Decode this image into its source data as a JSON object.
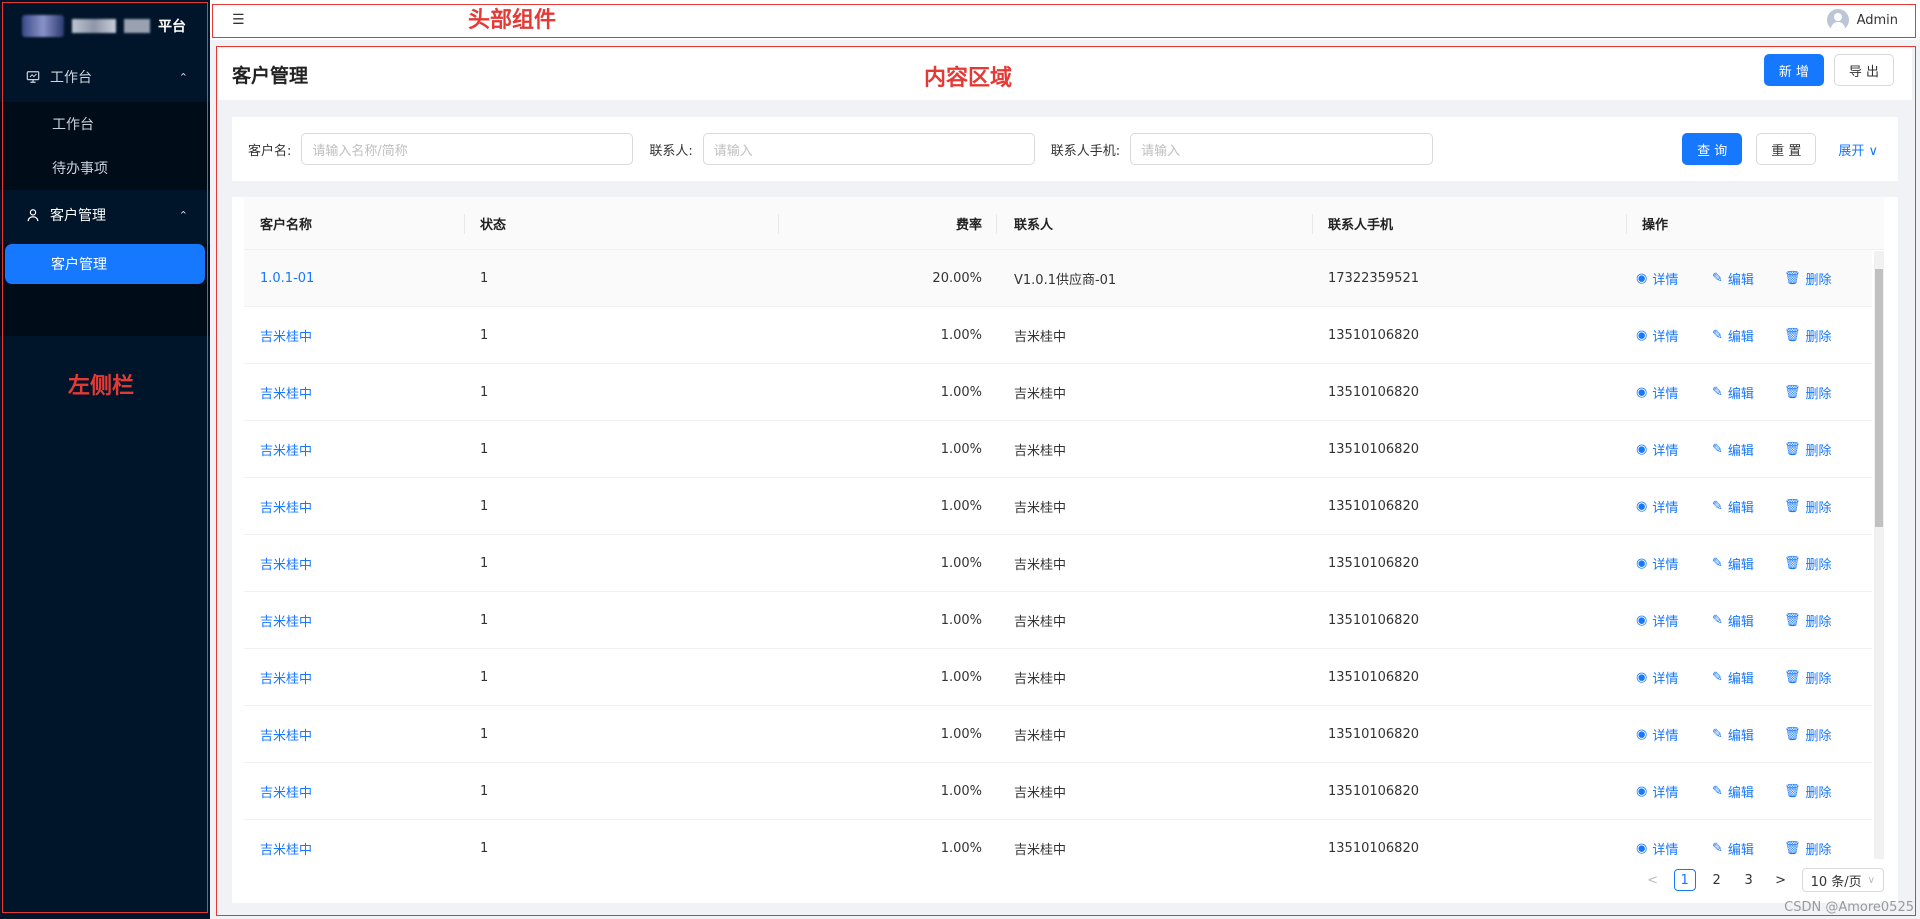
{
  "sidebar": {
    "brand_title": "平台",
    "groups": [
      {
        "label": "工作台",
        "icon": "monitor-icon",
        "chevron": "⌃",
        "items": [
          "工作台",
          "待办事项"
        ]
      },
      {
        "label": "客户管理",
        "icon": "user-icon",
        "chevron": "⌃",
        "items": [
          "客户管理"
        ]
      }
    ]
  },
  "header": {
    "toggle_icon": "☰",
    "user_name": "Admin"
  },
  "annotations": {
    "header": "头部组件",
    "content": "内容区域",
    "sidebar": "左侧栏"
  },
  "page": {
    "title": "客户管理",
    "add_label": "新 增",
    "export_label": "导 出"
  },
  "filter": {
    "customer_label": "客户名:",
    "customer_placeholder": "请输入名称/简称",
    "contact_label": "联系人:",
    "contact_placeholder": "请输入",
    "phone_label": "联系人手机:",
    "phone_placeholder": "请输入",
    "search_label": "查 询",
    "reset_label": "重 置",
    "expand_label": "展开 ∨"
  },
  "table": {
    "columns": [
      "客户名称",
      "状态",
      "费率",
      "联系人",
      "联系人手机",
      "操作"
    ],
    "actions": {
      "view": "详情",
      "edit": "编辑",
      "delete": "删除"
    },
    "rows": [
      {
        "name": "1.0.1-01",
        "status": "1",
        "rate": "20.00%",
        "contact": "V1.0.1供应商-01",
        "phone": "17322359521"
      },
      {
        "name": "吉米桂中",
        "status": "1",
        "rate": "1.00%",
        "contact": "吉米桂中",
        "phone": "13510106820"
      },
      {
        "name": "吉米桂中",
        "status": "1",
        "rate": "1.00%",
        "contact": "吉米桂中",
        "phone": "13510106820"
      },
      {
        "name": "吉米桂中",
        "status": "1",
        "rate": "1.00%",
        "contact": "吉米桂中",
        "phone": "13510106820"
      },
      {
        "name": "吉米桂中",
        "status": "1",
        "rate": "1.00%",
        "contact": "吉米桂中",
        "phone": "13510106820"
      },
      {
        "name": "吉米桂中",
        "status": "1",
        "rate": "1.00%",
        "contact": "吉米桂中",
        "phone": "13510106820"
      },
      {
        "name": "吉米桂中",
        "status": "1",
        "rate": "1.00%",
        "contact": "吉米桂中",
        "phone": "13510106820"
      },
      {
        "name": "吉米桂中",
        "status": "1",
        "rate": "1.00%",
        "contact": "吉米桂中",
        "phone": "13510106820"
      },
      {
        "name": "吉米桂中",
        "status": "1",
        "rate": "1.00%",
        "contact": "吉米桂中",
        "phone": "13510106820"
      },
      {
        "name": "吉米桂中",
        "status": "1",
        "rate": "1.00%",
        "contact": "吉米桂中",
        "phone": "13510106820"
      },
      {
        "name": "吉米桂中",
        "status": "1",
        "rate": "1.00%",
        "contact": "吉米桂中",
        "phone": "13510106820"
      }
    ]
  },
  "pagination": {
    "prev": "<",
    "pages": [
      "1",
      "2",
      "3"
    ],
    "current": "1",
    "next": ">",
    "page_size": "10 条/页"
  },
  "watermark": "CSDN @Amore0525",
  "colors": {
    "primary": "#1677ff",
    "sidebar_bg": "#001529",
    "annotation": "#e53935"
  }
}
